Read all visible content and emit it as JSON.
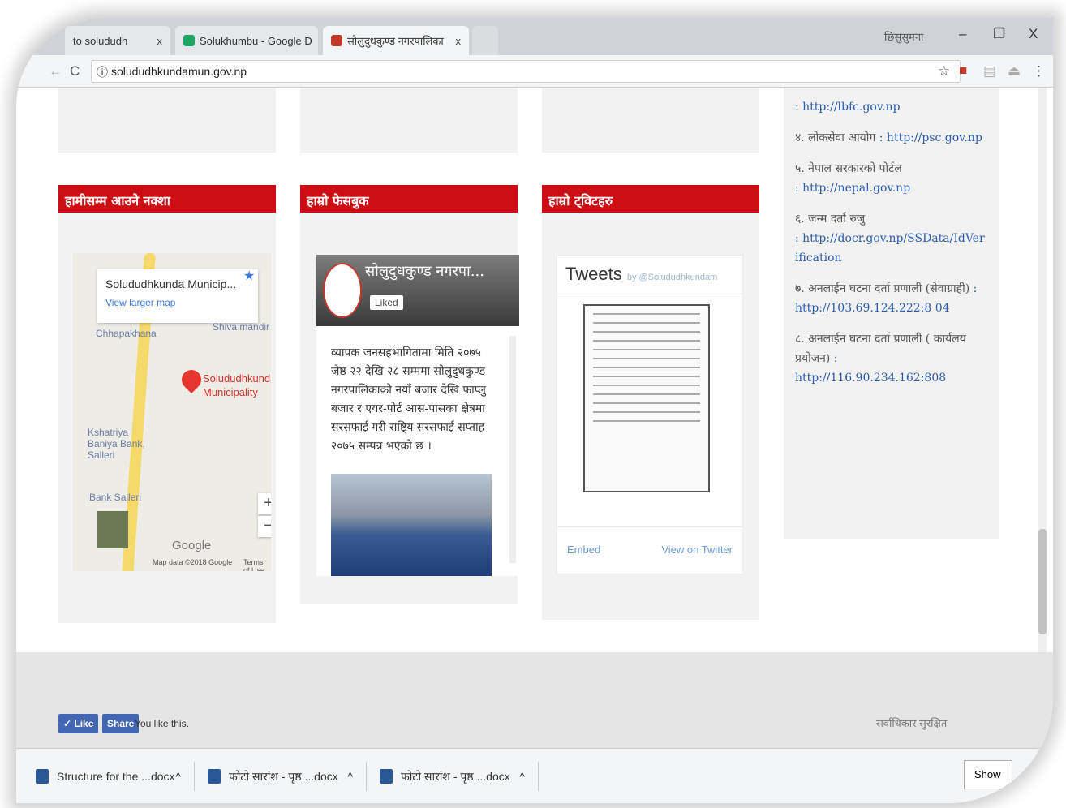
{
  "tabs": [
    {
      "label": "to solududh",
      "close": "x"
    },
    {
      "label": "Solukhumbu - Google D",
      "close": "x"
    },
    {
      "label": "सोलुदुधकुण्ड नगरपालिका",
      "close": "x"
    }
  ],
  "window_controls": {
    "minimize": "–",
    "restore": "❐",
    "close": "X",
    "profile": "छिसुसुमना"
  },
  "address_bar": {
    "url": "solududhkundamun.gov.np",
    "info_glyph": "ⓘ",
    "back": "←",
    "reload": "C"
  },
  "sections": {
    "map_title": "हामीसम्म आउने नक्शा",
    "facebook_title": "हाम्रो फेसबुक",
    "twitter_title": "हाम्रो ट्विटहरु"
  },
  "map": {
    "place_name": "Solududhkunda Municip...",
    "view_larger": "View larger map",
    "labels": [
      "Chhapakhana",
      "Shiva mandir",
      "Solududhkunda Municipality",
      "Kshatriya Baniya Bank, Salleri",
      "Bank Salleri"
    ],
    "google": "Google",
    "attribution": "Map data ©2018 Google",
    "terms": "Terms of Use",
    "zoom_in": "+",
    "zoom_out": "−"
  },
  "facebook": {
    "page_name": "सोलुदुधकुण्ड नगरपा...",
    "liked": "Liked",
    "post": "व्यापक जनसहभागितामा मिति २०७५ जेष्ठ २२ देखि २८ सम्ममा सोलुदुधकुण्ड नगरपालिकाको नयाँ बजार देखि फाप्लु बजार र एयर-पोर्ट आस-पासका क्षेत्रमा सरसफाई गरी राष्ट्रिय सरसफाई सप्ताह २०७५ सम्पन्न भएको छ ।"
  },
  "twitter": {
    "header": "Tweets",
    "by": "by @Solududhkundam",
    "embed": "Embed",
    "view": "View on Twitter"
  },
  "links": [
    {
      "prefix": "",
      "url": ": http://lbfc.gov.np"
    },
    {
      "prefix": "४. लोकसेवा आयोग",
      "url": ": http://psc.gov.np"
    },
    {
      "prefix": "५. नेपाल सरकारको पोर्टल",
      "url": ": http://nepal.gov.np"
    },
    {
      "prefix": "६. जन्म दर्ता रुजु",
      "url": ": http://docr.gov.np/SSData/IdVerification"
    },
    {
      "prefix": "७. अनलाईन घटना दर्ता प्रणाली (सेवाग्राही)",
      "url": ": http://103.69.124.222:8 04"
    },
    {
      "prefix": "८. अनलाईन घटना दर्ता प्रणाली ( कार्यलय प्रयोजन)",
      "url": ": http://116.90.234.162:808"
    }
  ],
  "footer": {
    "like": "✓ Like",
    "share": "Share",
    "you_like": "You like this.",
    "copyright": "सर्वाधिकार सुरक्षित"
  },
  "downloads": [
    {
      "name": "Structure for the ...docx",
      "caret": "^"
    },
    {
      "name": "फोटो सारांश - पृष्ठ....docx",
      "caret": "^"
    },
    {
      "name": "फोटो सारांश - पृष्ठ....docx",
      "caret": "^"
    }
  ],
  "show_all": "Show"
}
